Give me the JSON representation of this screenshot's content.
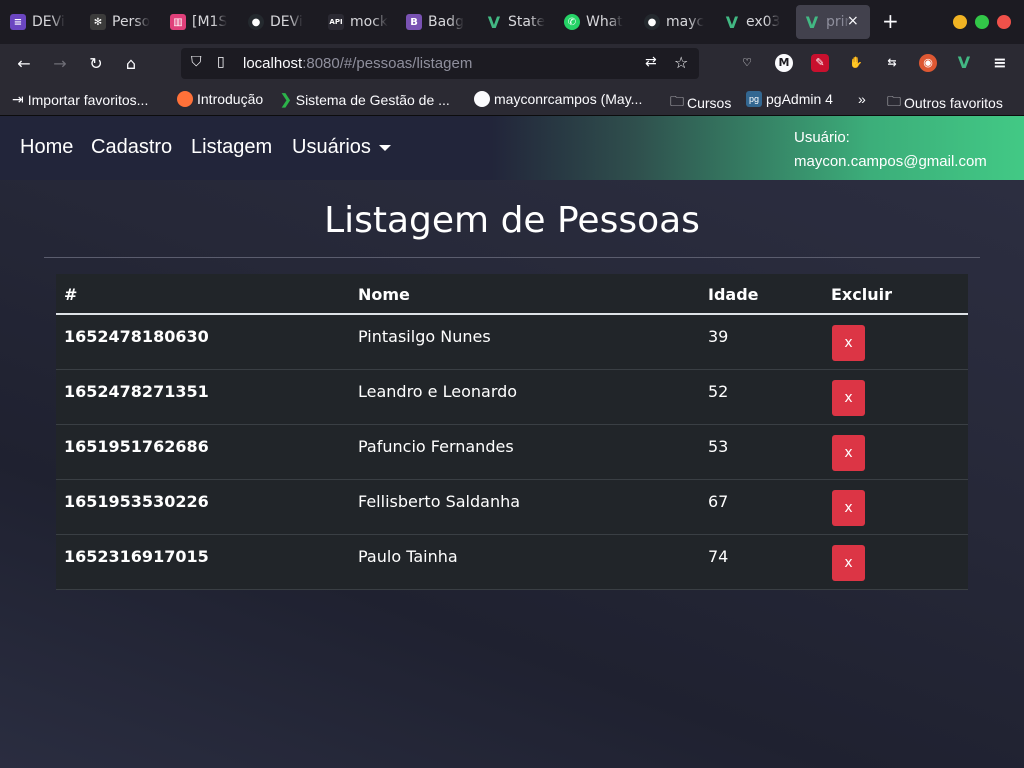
{
  "browser": {
    "tabs": [
      {
        "label": "DEVi",
        "icon_color": "#6b46c1"
      },
      {
        "label": "Perso",
        "icon_color": "#3b3b3b"
      },
      {
        "label": "[M1S",
        "icon_color": "#e0407a"
      },
      {
        "label": "DEVi",
        "icon_color": "#24292e"
      },
      {
        "label": "mock",
        "icon_color": "#2b2a33"
      },
      {
        "label": "Badg",
        "icon_color": "#7952b3"
      },
      {
        "label": "State",
        "icon_color": "#42b883"
      },
      {
        "label": "What",
        "icon_color": "#25d366"
      },
      {
        "label": "mayc",
        "icon_color": "#24292e"
      },
      {
        "label": "ex03",
        "icon_color": "#42b883"
      },
      {
        "label": "prir",
        "icon_color": "#42b883"
      }
    ],
    "new_tab_label": "+",
    "close_label": "×",
    "url": {
      "host": "localhost",
      "rest": ":8080/#/pessoas/listagem"
    },
    "bookmarks": [
      {
        "label": "Importar favoritos..."
      },
      {
        "label": "Introdução"
      },
      {
        "label": "Sistema de Gestão de ..."
      },
      {
        "label": "mayconrcampos (May..."
      },
      {
        "label": "Cursos"
      },
      {
        "label": "pgAdmin 4"
      },
      {
        "label": "Outros favoritos"
      }
    ],
    "more_label": "»"
  },
  "app_nav": {
    "links": [
      "Home",
      "Cadastro",
      "Listagem",
      "Usuários"
    ],
    "user_label": "Usuário:",
    "user_email": "maycon.campos@gmail.com"
  },
  "page": {
    "title": "Listagem de Pessoas",
    "columns": [
      "#",
      "Nome",
      "Idade",
      "Excluir"
    ],
    "rows": [
      {
        "id": "1652478180630",
        "nome": "Pintasilgo Nunes",
        "idade": "39",
        "action": "x"
      },
      {
        "id": "1652478271351",
        "nome": "Leandro e Leonardo",
        "idade": "52",
        "action": "x"
      },
      {
        "id": "1651951762686",
        "nome": "Pafuncio Fernandes",
        "idade": "53",
        "action": "x"
      },
      {
        "id": "1651953530226",
        "nome": "Fellisberto Saldanha",
        "idade": "67",
        "action": "x"
      },
      {
        "id": "1652316917015",
        "nome": "Paulo Tainha",
        "idade": "74",
        "action": "x"
      }
    ]
  },
  "colors": {
    "danger": "#dc3545",
    "accent_green": "#42c985"
  }
}
